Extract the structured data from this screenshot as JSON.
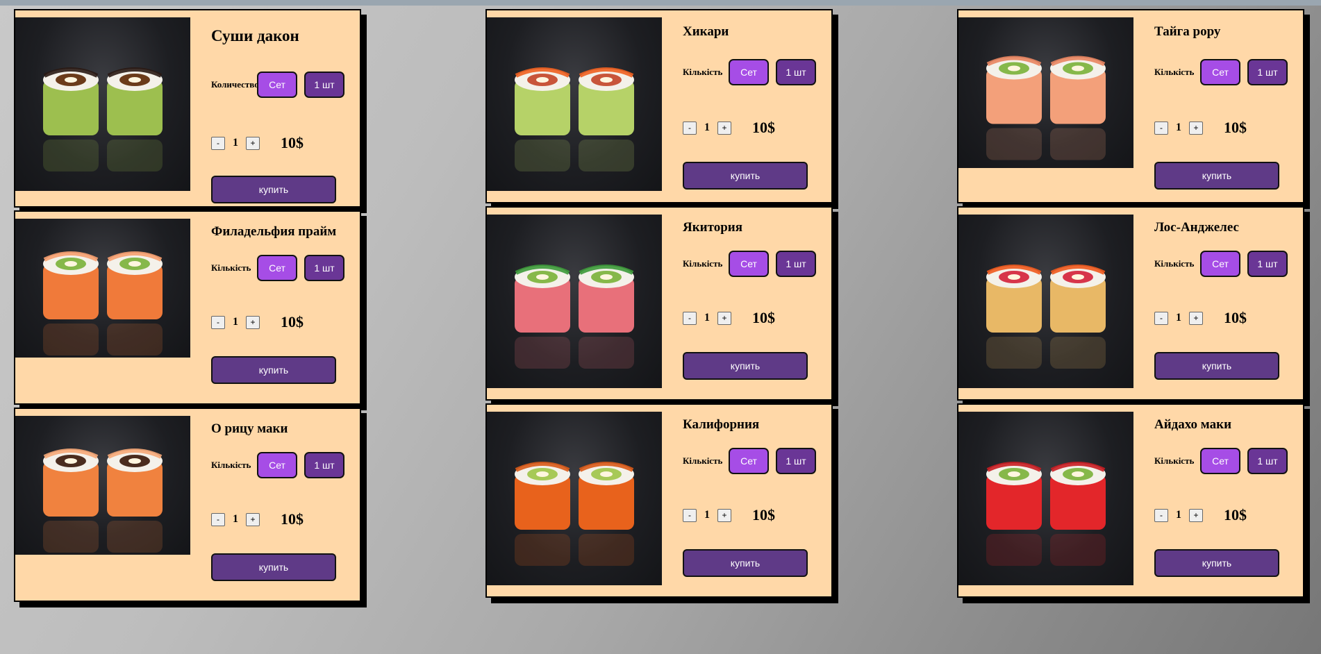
{
  "colors": {
    "card_bg": "#ffd8a8",
    "set_button": "#a64de6",
    "piece_button": "#6a3696",
    "buy_button": "#5f3a87"
  },
  "columns": [
    {
      "cards": [
        {
          "name": "Суши дакон",
          "qty_label": "Количество",
          "set_label": "Сет",
          "piece_label": "1 шт",
          "count": "1",
          "price": "10$",
          "buy_label": "купить",
          "minus": "-",
          "plus": "+",
          "image": "roll-avocado-eel-sauce"
        },
        {
          "name": "Филадельфия прайм",
          "qty_label": "Кількість",
          "set_label": "Сет",
          "piece_label": "1 шт",
          "count": "1",
          "price": "10$",
          "buy_label": "купить",
          "minus": "-",
          "plus": "+",
          "image": "roll-salmon"
        },
        {
          "name": "О рицу маки",
          "qty_label": "Кількість",
          "set_label": "Сет",
          "piece_label": "1 шт",
          "count": "1",
          "price": "10$",
          "buy_label": "купить",
          "minus": "-",
          "plus": "+",
          "image": "roll-salmon-eel"
        }
      ]
    },
    {
      "cards": [
        {
          "name": "Хикари",
          "qty_label": "Кількість",
          "set_label": "Сет",
          "piece_label": "1 шт",
          "count": "1",
          "price": "10$",
          "buy_label": "купить",
          "minus": "-",
          "plus": "+",
          "image": "roll-avocado-caviar"
        },
        {
          "name": "Якитория",
          "qty_label": "Кількість",
          "set_label": "Сет",
          "piece_label": "1 шт",
          "count": "1",
          "price": "10$",
          "buy_label": "купить",
          "minus": "-",
          "plus": "+",
          "image": "roll-tuna"
        },
        {
          "name": "Калифорния",
          "qty_label": "Кількість",
          "set_label": "Сет",
          "piece_label": "1 шт",
          "count": "1",
          "price": "10$",
          "buy_label": "купить",
          "minus": "-",
          "plus": "+",
          "image": "roll-tobiko-orange"
        }
      ]
    },
    {
      "cards": [
        {
          "name": "Тайга рору",
          "qty_label": "Кількість",
          "set_label": "Сет",
          "piece_label": "1 шт",
          "count": "1",
          "price": "10$",
          "buy_label": "купить",
          "minus": "-",
          "plus": "+",
          "image": "roll-seared-salmon"
        },
        {
          "name": "Лос-Анджелес",
          "qty_label": "Кількість",
          "set_label": "Сет",
          "piece_label": "1 шт",
          "count": "1",
          "price": "10$",
          "buy_label": "купить",
          "minus": "-",
          "plus": "+",
          "image": "roll-tempura"
        },
        {
          "name": "Айдахо маки",
          "qty_label": "Кількість",
          "set_label": "Сет",
          "piece_label": "1 шт",
          "count": "1",
          "price": "10$",
          "buy_label": "купить",
          "minus": "-",
          "plus": "+",
          "image": "roll-tobiko-red"
        }
      ]
    }
  ]
}
